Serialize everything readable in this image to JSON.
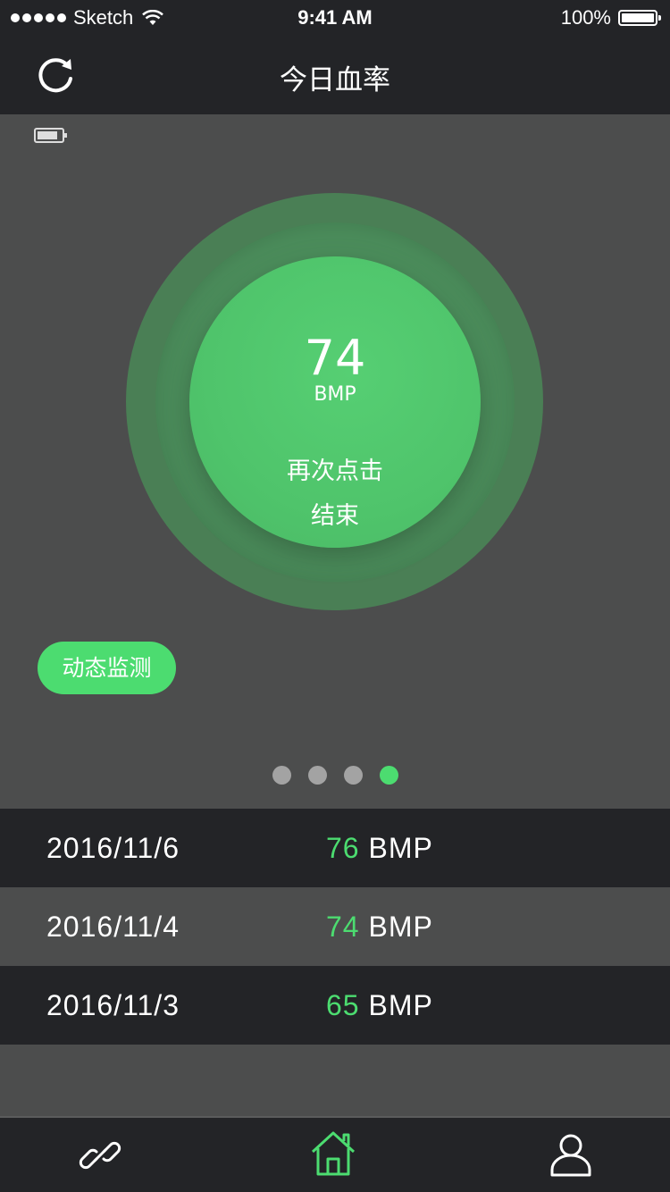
{
  "status_bar": {
    "carrier": "Sketch",
    "time": "9:41 AM",
    "battery_percent": "100%"
  },
  "nav": {
    "title": "今日血率",
    "left_icon": "refresh-icon"
  },
  "hero": {
    "device_icon": "battery-icon",
    "bpm_value": "74",
    "bpm_unit": "BMP",
    "tap_line1": "再次点击",
    "tap_line2": "结束",
    "monitor_label": "动态监测",
    "pager": {
      "count": 4,
      "active_index": 3
    }
  },
  "history": [
    {
      "date": "2016/11/6",
      "value": "76",
      "unit": "BMP"
    },
    {
      "date": "2016/11/4",
      "value": "74",
      "unit": "BMP"
    },
    {
      "date": "2016/11/3",
      "value": "65",
      "unit": "BMP"
    }
  ],
  "tab_bar": {
    "tabs": [
      {
        "icon": "link-icon",
        "active": false
      },
      {
        "icon": "home-icon",
        "active": true
      },
      {
        "icon": "user-icon",
        "active": false
      }
    ]
  },
  "colors": {
    "accent": "#4cdc70",
    "dark_bg": "#232427",
    "mid_bg": "#4c4d4d",
    "inactive_icon": "#ffffff"
  }
}
